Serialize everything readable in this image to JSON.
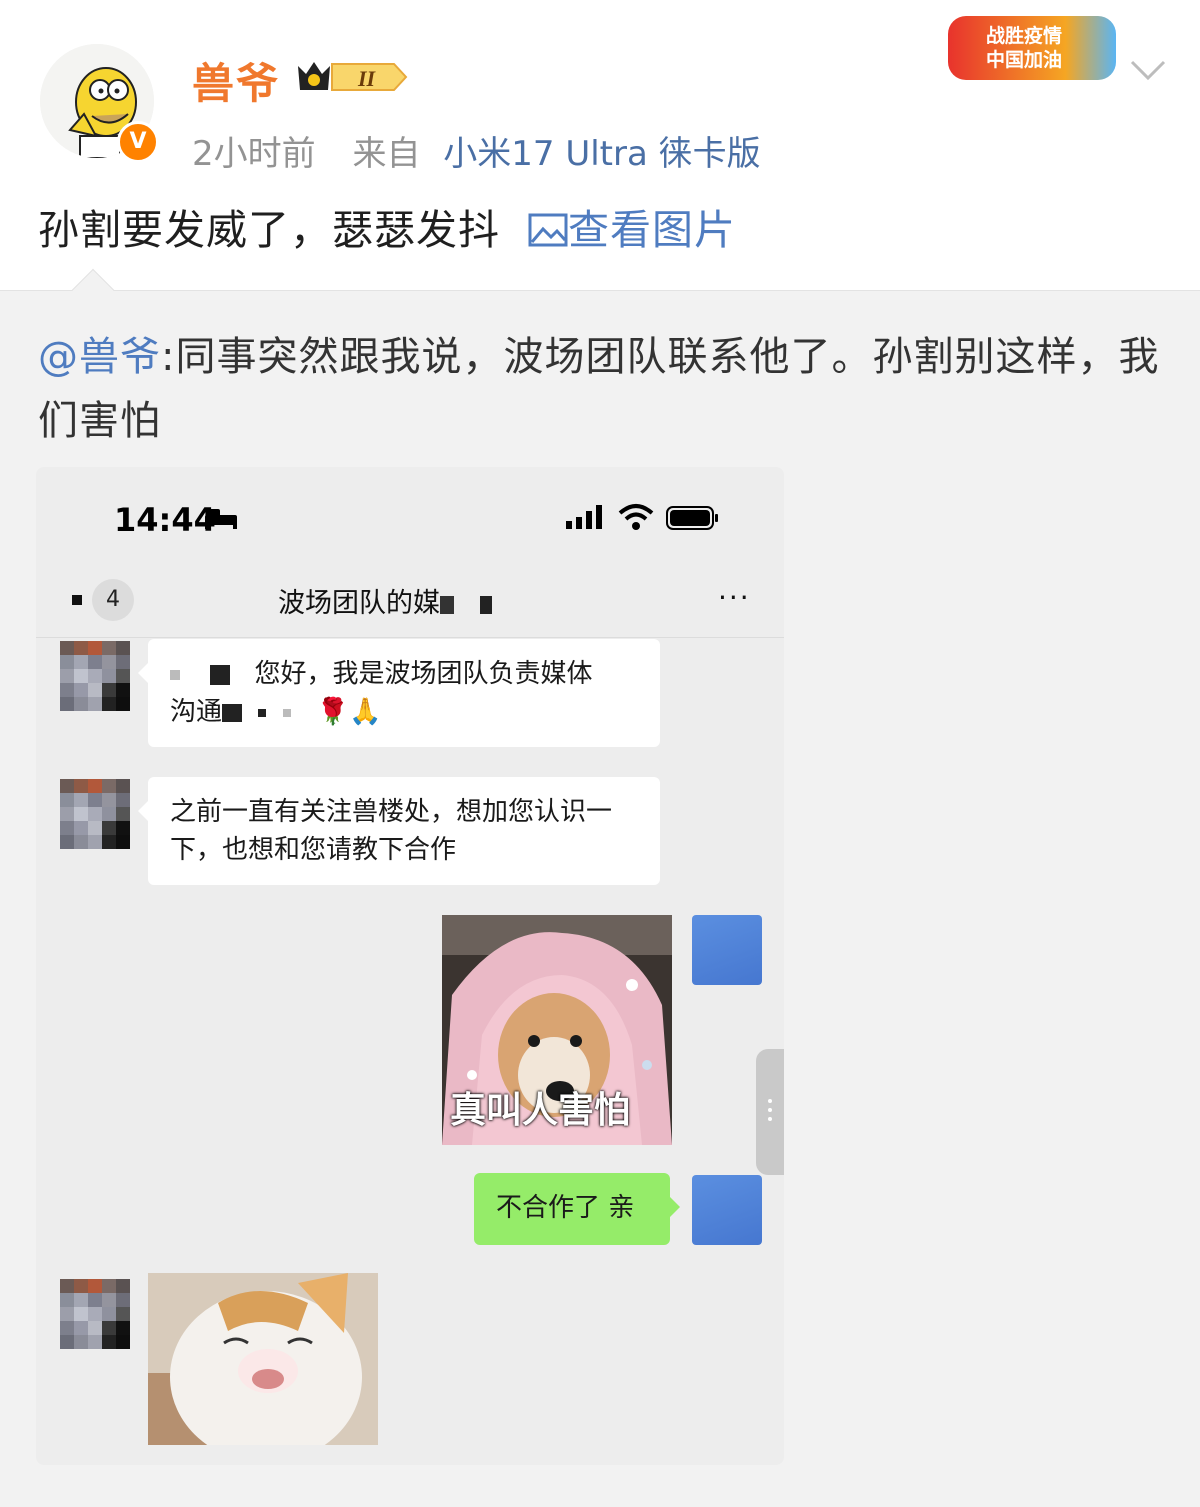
{
  "post": {
    "username": "兽爷",
    "vip_level": "II",
    "verified_badge": "V",
    "time": "2小时前",
    "source_prefix": "来自",
    "device": "小米17 Ultra 徕卡版",
    "text": "孙割要发威了，瑟瑟发抖",
    "view_image_label": "查看图片",
    "campaign_badge": {
      "line1": "战胜疫情",
      "line2": "中国加油"
    },
    "icons": [
      "cartoon-avatar",
      "verified-icon",
      "vip-crown-icon",
      "chevron-down-icon",
      "picture-icon"
    ]
  },
  "repost": {
    "mention": "@兽爷",
    "text": ":同事突然跟我说，波场团队联系他了。孙割别这样，我们害怕"
  },
  "screenshot": {
    "status_time": "14:44",
    "chat_unread_count": "4",
    "chat_title": "波场团队的媒",
    "more_label": "···",
    "messages": [
      {
        "side": "left",
        "text_before": "您好，我是波场团队负责媒体",
        "text_line2": "沟通",
        "emoji": "🌹🙏"
      },
      {
        "side": "left",
        "text": "之前一直有关注兽楼处，想加您认识一下，也想和您请教下合作"
      },
      {
        "side": "right",
        "type": "sticker",
        "caption": "真叫人害怕"
      },
      {
        "side": "right",
        "text": "不合作了 亲"
      },
      {
        "side": "left",
        "type": "sticker",
        "caption": ""
      }
    ],
    "colors": {
      "chat_bg": "#ededed",
      "self_bubble": "#95ec69",
      "accent_blue": "#4f7cc0"
    }
  }
}
